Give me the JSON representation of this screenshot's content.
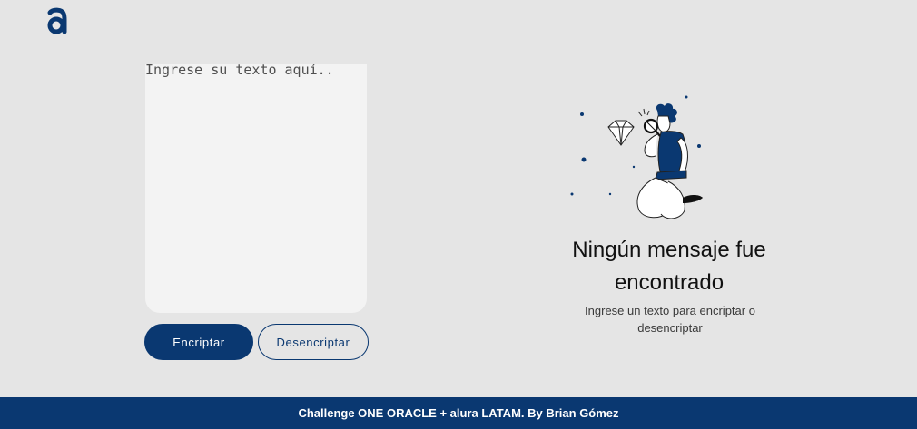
{
  "colors": {
    "background": "#e5e5e5",
    "primary": "#0a3871",
    "panel": "#f3f3f3"
  },
  "header": {
    "logo_icon": "alura-a-logo"
  },
  "input": {
    "placeholder": "Ingrese su texto aquí.."
  },
  "buttons": {
    "encrypt_label": "Encriptar",
    "decrypt_label": "Desencriptar"
  },
  "output": {
    "illustration_icon": "person-with-magnifying-glass-and-diamond",
    "title": "Ningún mensaje fue encontrado",
    "subtitle": "Ingrese un texto para encriptar o desencriptar"
  },
  "footer": {
    "text": "Challenge ONE ORACLE + alura LATAM. By Brian Gómez"
  }
}
